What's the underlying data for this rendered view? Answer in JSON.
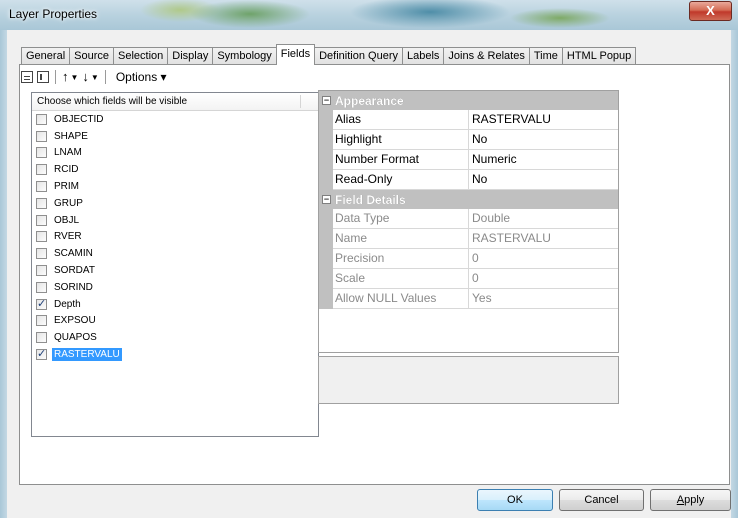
{
  "window": {
    "title": "Layer Properties",
    "close_label": "X"
  },
  "tabs": [
    {
      "label": "General",
      "active": false
    },
    {
      "label": "Source",
      "active": false
    },
    {
      "label": "Selection",
      "active": false
    },
    {
      "label": "Display",
      "active": false
    },
    {
      "label": "Symbology",
      "active": false
    },
    {
      "label": "Fields",
      "active": true
    },
    {
      "label": "Definition Query",
      "active": false
    },
    {
      "label": "Labels",
      "active": false
    },
    {
      "label": "Joins & Relates",
      "active": false
    },
    {
      "label": "Time",
      "active": false
    },
    {
      "label": "HTML Popup",
      "active": false
    }
  ],
  "toolbar": {
    "up_arrow": "↑",
    "down_arrow": "↓",
    "caret": "▼",
    "options_label": "Options ▾"
  },
  "fields_list": {
    "header": "Choose which fields will be visible",
    "items": [
      {
        "label": "OBJECTID",
        "checked": false,
        "selected": false
      },
      {
        "label": "SHAPE",
        "checked": false,
        "selected": false
      },
      {
        "label": "LNAM",
        "checked": false,
        "selected": false
      },
      {
        "label": "RCID",
        "checked": false,
        "selected": false
      },
      {
        "label": "PRIM",
        "checked": false,
        "selected": false
      },
      {
        "label": "GRUP",
        "checked": false,
        "selected": false
      },
      {
        "label": "OBJL",
        "checked": false,
        "selected": false
      },
      {
        "label": "RVER",
        "checked": false,
        "selected": false
      },
      {
        "label": "SCAMIN",
        "checked": false,
        "selected": false
      },
      {
        "label": "SORDAT",
        "checked": false,
        "selected": false
      },
      {
        "label": "SORIND",
        "checked": false,
        "selected": false
      },
      {
        "label": "Depth",
        "checked": true,
        "selected": false
      },
      {
        "label": "EXPSOU",
        "checked": false,
        "selected": false
      },
      {
        "label": "QUAPOS",
        "checked": false,
        "selected": false
      },
      {
        "label": "RASTERVALU",
        "checked": true,
        "selected": true
      }
    ]
  },
  "properties": {
    "appearance": {
      "title": "Appearance",
      "toggle": "⊟",
      "rows": [
        {
          "name": "Alias",
          "value": "RASTERVALU"
        },
        {
          "name": "Highlight",
          "value": "No"
        },
        {
          "name": "Number Format",
          "value": "Numeric"
        },
        {
          "name": "Read-Only",
          "value": "No"
        }
      ]
    },
    "field_details": {
      "title": "Field Details",
      "toggle": "⊟",
      "rows": [
        {
          "name": "Data Type",
          "value": "Double"
        },
        {
          "name": "Name",
          "value": "RASTERVALU"
        },
        {
          "name": "Precision",
          "value": "0"
        },
        {
          "name": "Scale",
          "value": "0"
        },
        {
          "name": "Allow NULL Values",
          "value": "Yes"
        }
      ]
    }
  },
  "buttons": {
    "ok": "OK",
    "cancel": "Cancel",
    "apply_first": "A",
    "apply_rest": "pply"
  }
}
